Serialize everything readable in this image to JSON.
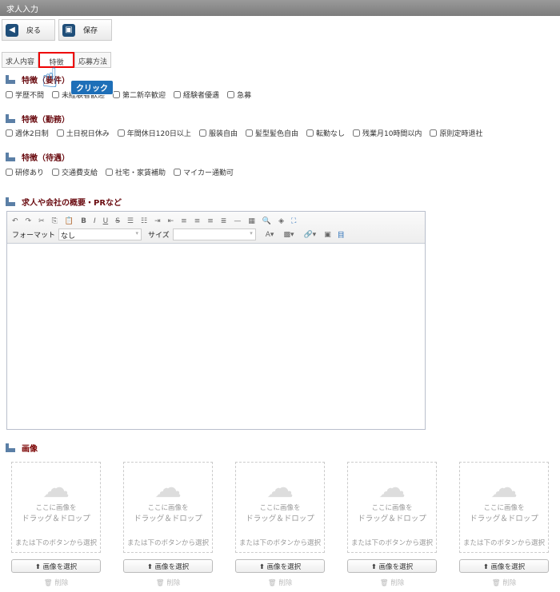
{
  "title": "求人入力",
  "buttons": {
    "back": "戻る",
    "save": "保存"
  },
  "tabs": [
    "求人内容",
    "特徴",
    "応募方法"
  ],
  "sections": {
    "requirements": {
      "heading": "特徴（要件）",
      "items": [
        "学歴不問",
        "未経験者歓迎",
        "第二新卒歓迎",
        "経験者優遇",
        "急募"
      ]
    },
    "work": {
      "heading": "特徴（勤務）",
      "items": [
        "週休2日制",
        "土日祝日休み",
        "年間休日120日以上",
        "服装自由",
        "髪型髪色自由",
        "転勤なし",
        "残業月10時間以内",
        "原則定時退社"
      ]
    },
    "benefits": {
      "heading": "特徴（待遇）",
      "items": [
        "研修あり",
        "交通費支給",
        "社宅・家賃補助",
        "マイカー通勤可"
      ]
    },
    "pr": {
      "heading": "求人や会社の概要・PRなど"
    },
    "images": {
      "heading": "画像"
    }
  },
  "editor": {
    "format_label": "フォーマット",
    "format_value": "なし",
    "size_label": "サイズ",
    "size_value": ""
  },
  "upload": {
    "drop_line1": "ここに画像を",
    "drop_line2": "ドラッグ＆ドロップ",
    "or_text": "または下のボタンから選択",
    "select_label": "画像を選択",
    "delete_label": "削除"
  },
  "annotation": {
    "click_label": "クリック"
  },
  "colors": {
    "heading": "#6b0d12",
    "highlight": "#ee0000",
    "accent": "#1e6fb8"
  }
}
